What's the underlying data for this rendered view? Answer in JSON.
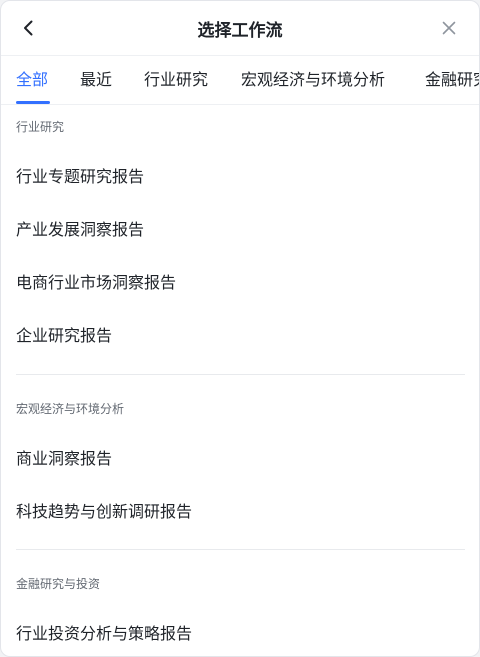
{
  "header": {
    "title": "选择工作流",
    "back_icon": "chevron-left-icon",
    "close_icon": "close-icon"
  },
  "tabs": [
    {
      "label": "全部",
      "active": true
    },
    {
      "label": "最近",
      "active": false
    },
    {
      "label": "行业研究",
      "active": false
    },
    {
      "label": "宏观经济与环境分析",
      "active": false
    },
    {
      "label": "金融研究",
      "active": false
    }
  ],
  "sections": [
    {
      "label": "行业研究",
      "items": [
        "行业专题研究报告",
        "产业发展洞察报告",
        "电商行业市场洞察报告",
        "企业研究报告"
      ]
    },
    {
      "label": "宏观经济与环境分析",
      "items": [
        "商业洞察报告",
        "科技趋势与创新调研报告"
      ]
    },
    {
      "label": "金融研究与投资",
      "items": [
        "行业投资分析与策略报告"
      ]
    }
  ],
  "colors": {
    "accent": "#3370ff",
    "text": "#1f2329",
    "secondary_text": "#646a73"
  }
}
